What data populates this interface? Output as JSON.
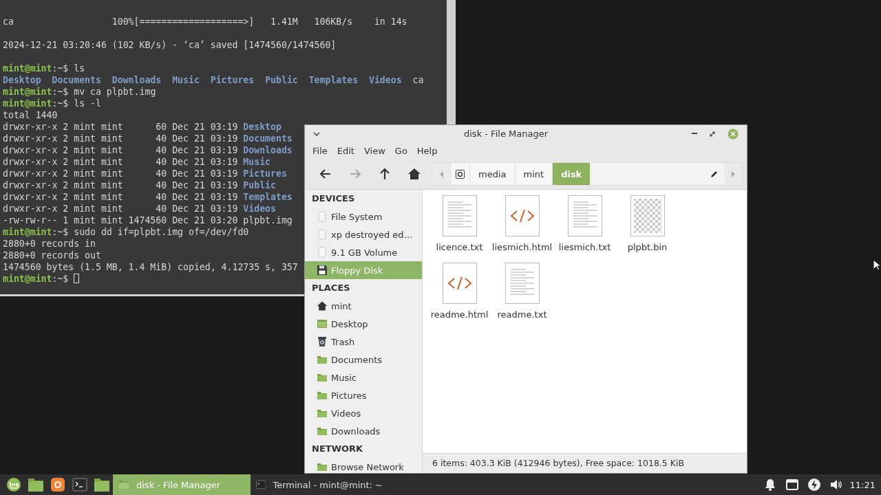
{
  "terminal": {
    "lines": [
      {
        "kind": "line",
        "segments": [
          {
            "kind": "text",
            "text": "ca                  100%[===================>]   1.41M   106KB/s    in 14s"
          }
        ]
      },
      {
        "kind": "blank"
      },
      {
        "kind": "line",
        "segments": [
          {
            "kind": "text",
            "text": "2024-12-21 03:20:46 (102 KB/s) - ‘ca’ saved [1474560/1474560]"
          }
        ]
      },
      {
        "kind": "blank"
      },
      {
        "kind": "line",
        "segments": [
          {
            "kind": "user",
            "text": "mint@mint"
          },
          {
            "kind": "text",
            "text": ":~$ ls"
          }
        ]
      },
      {
        "kind": "columns",
        "segments": [
          {
            "kind": "dir",
            "text": "Desktop"
          },
          {
            "kind": "dir",
            "text": "Documents"
          },
          {
            "kind": "dir",
            "text": "Downloads"
          },
          {
            "kind": "dir",
            "text": "Music"
          },
          {
            "kind": "dir",
            "text": "Pictures"
          },
          {
            "kind": "dir",
            "text": "Public"
          },
          {
            "kind": "dir",
            "text": "Templates"
          },
          {
            "kind": "dir",
            "text": "Videos"
          },
          {
            "kind": "text",
            "text": "ca"
          }
        ]
      },
      {
        "kind": "line",
        "segments": [
          {
            "kind": "user",
            "text": "mint@mint"
          },
          {
            "kind": "text",
            "text": ":~$ mv ca plpbt.img"
          }
        ]
      },
      {
        "kind": "line",
        "segments": [
          {
            "kind": "user",
            "text": "mint@mint"
          },
          {
            "kind": "text",
            "text": ":~$ ls -l"
          }
        ]
      },
      {
        "kind": "line",
        "segments": [
          {
            "kind": "text",
            "text": "total 1440"
          }
        ]
      },
      {
        "kind": "line",
        "segments": [
          {
            "kind": "text",
            "text": "drwxr-xr-x 2 mint mint      60 Dec 21 03:19 "
          },
          {
            "kind": "dir",
            "text": "Desktop"
          }
        ]
      },
      {
        "kind": "line",
        "segments": [
          {
            "kind": "text",
            "text": "drwxr-xr-x 2 mint mint      40 Dec 21 03:19 "
          },
          {
            "kind": "dir",
            "text": "Documents"
          }
        ]
      },
      {
        "kind": "line",
        "segments": [
          {
            "kind": "text",
            "text": "drwxr-xr-x 2 mint mint      40 Dec 21 03:19 "
          },
          {
            "kind": "dir",
            "text": "Downloads"
          }
        ]
      },
      {
        "kind": "line",
        "segments": [
          {
            "kind": "text",
            "text": "drwxr-xr-x 2 mint mint      40 Dec 21 03:19 "
          },
          {
            "kind": "dir",
            "text": "Music"
          }
        ]
      },
      {
        "kind": "line",
        "segments": [
          {
            "kind": "text",
            "text": "drwxr-xr-x 2 mint mint      40 Dec 21 03:19 "
          },
          {
            "kind": "dir",
            "text": "Pictures"
          }
        ]
      },
      {
        "kind": "line",
        "segments": [
          {
            "kind": "text",
            "text": "drwxr-xr-x 2 mint mint      40 Dec 21 03:19 "
          },
          {
            "kind": "dir",
            "text": "Public"
          }
        ]
      },
      {
        "kind": "line",
        "segments": [
          {
            "kind": "text",
            "text": "drwxr-xr-x 2 mint mint      40 Dec 21 03:19 "
          },
          {
            "kind": "dir",
            "text": "Templates"
          }
        ]
      },
      {
        "kind": "line",
        "segments": [
          {
            "kind": "text",
            "text": "drwxr-xr-x 2 mint mint      40 Dec 21 03:19 "
          },
          {
            "kind": "dir",
            "text": "Videos"
          }
        ]
      },
      {
        "kind": "line",
        "segments": [
          {
            "kind": "text",
            "text": "-rw-rw-r-- 1 mint mint 1474560 Dec 21 03:20 plpbt.img"
          }
        ]
      },
      {
        "kind": "line",
        "segments": [
          {
            "kind": "user",
            "text": "mint@mint"
          },
          {
            "kind": "text",
            "text": ":~$ sudo dd if=plpbt.img of=/dev/fd0"
          }
        ]
      },
      {
        "kind": "line",
        "segments": [
          {
            "kind": "text",
            "text": "2880+0 records in"
          }
        ]
      },
      {
        "kind": "line",
        "segments": [
          {
            "kind": "text",
            "text": "2880+0 records out"
          }
        ]
      },
      {
        "kind": "line",
        "segments": [
          {
            "kind": "text",
            "text": "1474560 bytes (1.5 MB, 1.4 MiB) copied, 4.12735 s, 357"
          }
        ]
      },
      {
        "kind": "prompt",
        "segments": [
          {
            "kind": "user",
            "text": "mint@mint"
          },
          {
            "kind": "text",
            "text": ":~$ "
          }
        ]
      }
    ]
  },
  "file_manager": {
    "window": {
      "title": "disk - File Manager"
    },
    "menu": [
      "File",
      "Edit",
      "View",
      "Go",
      "Help"
    ],
    "toolbar": [
      {
        "disabled": false
      },
      {
        "disabled": true
      },
      {
        "disabled": false
      },
      {
        "disabled": false
      }
    ],
    "breadcrumbs": [
      {
        "label": "media",
        "selected": false
      },
      {
        "label": "mint",
        "selected": false
      },
      {
        "label": "disk",
        "selected": true
      }
    ],
    "sidebar": [
      {
        "heading": "DEVICES",
        "items": [
          {
            "label": "File System",
            "kind": "drive",
            "selected": false
          },
          {
            "label": "xp destroyed ed…",
            "kind": "drive",
            "selected": false
          },
          {
            "label": "9.1 GB Volume",
            "kind": "drive",
            "selected": false
          },
          {
            "label": "Floppy Disk",
            "kind": "floppy",
            "selected": true
          }
        ]
      },
      {
        "heading": "PLACES",
        "items": [
          {
            "label": "mint",
            "kind": "home",
            "selected": false
          },
          {
            "label": "Desktop",
            "kind": "desktop",
            "selected": false
          },
          {
            "label": "Trash",
            "kind": "trash",
            "selected": false
          },
          {
            "label": "Documents",
            "kind": "folder",
            "selected": false
          },
          {
            "label": "Music",
            "kind": "folder",
            "selected": false
          },
          {
            "label": "Pictures",
            "kind": "folder",
            "selected": false
          },
          {
            "label": "Videos",
            "kind": "folder",
            "selected": false
          },
          {
            "label": "Downloads",
            "kind": "folder",
            "selected": false
          }
        ]
      },
      {
        "heading": "NETWORK",
        "items": [
          {
            "label": "Browse Network",
            "kind": "folder",
            "selected": false
          }
        ]
      }
    ],
    "files": [
      {
        "name": "licence.txt",
        "kind": "text"
      },
      {
        "name": "liesmich.html",
        "kind": "html"
      },
      {
        "name": "liesmich.txt",
        "kind": "text"
      },
      {
        "name": "plpbt.bin",
        "kind": "binary"
      },
      {
        "name": "readme.html",
        "kind": "html"
      },
      {
        "name": "readme.txt",
        "kind": "text"
      }
    ],
    "status_bar": "6 items: 403.3 KiB (412946 bytes), Free space: 1018.5 KiB"
  },
  "taskbar": {
    "tasks": [
      {
        "label": "disk - File Manager",
        "kind": "files",
        "selected": true
      },
      {
        "label": "Terminal - mint@mint: ~",
        "kind": "terminal",
        "selected": false
      }
    ],
    "clock": "11:21"
  }
}
